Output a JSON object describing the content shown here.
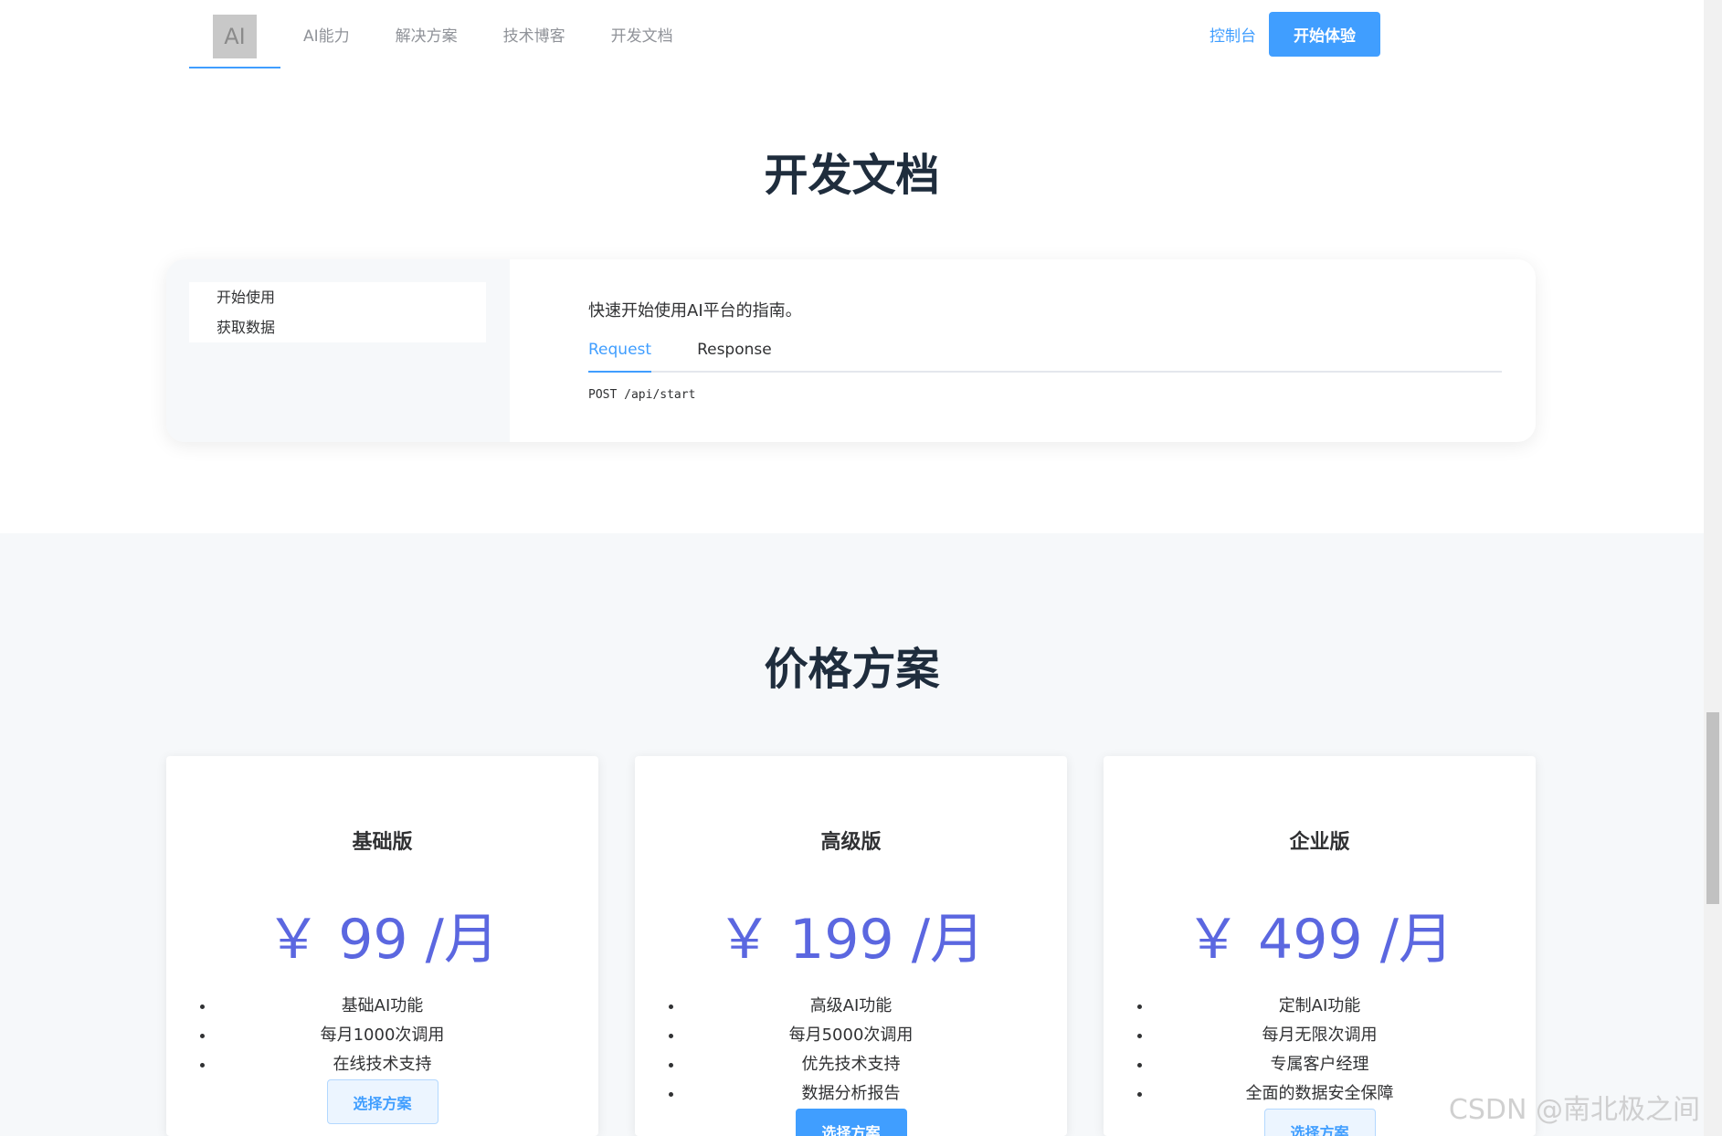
{
  "header": {
    "logo_text": "AI",
    "nav": [
      "AI能力",
      "解决方案",
      "技术博客",
      "开发文档"
    ],
    "console_label": "控制台",
    "start_label": "开始体验"
  },
  "docs": {
    "title": "开发文档",
    "menu": [
      "开始使用",
      "获取数据"
    ],
    "description": "快速开始使用AI平台的指南。",
    "tabs": [
      "Request",
      "Response"
    ],
    "active_tab": "Request",
    "code": "POST /api/start"
  },
  "pricing": {
    "title": "价格方案",
    "plans": [
      {
        "name": "基础版",
        "price": "￥ 99 /月",
        "features": [
          "基础AI功能",
          "每月1000次调用",
          "在线技术支持"
        ],
        "button": "选择方案",
        "button_style": "light"
      },
      {
        "name": "高级版",
        "price": "￥ 199 /月",
        "features": [
          "高级AI功能",
          "每月5000次调用",
          "优先技术支持",
          "数据分析报告"
        ],
        "button": "选择方案",
        "button_style": "solid"
      },
      {
        "name": "企业版",
        "price": "￥ 499 /月",
        "features": [
          "定制AI功能",
          "每月无限次调用",
          "专属客户经理",
          "全面的数据安全保障"
        ],
        "button": "选择方案",
        "button_style": "light"
      }
    ]
  },
  "watermark": "CSDN @南北极之间",
  "colors": {
    "accent": "#409eff",
    "price": "#5b67e0",
    "section_bg": "#f6f8fa"
  }
}
